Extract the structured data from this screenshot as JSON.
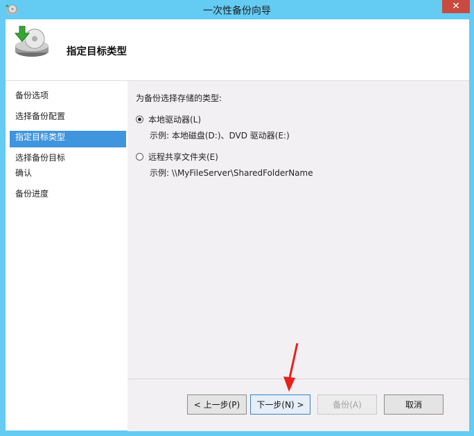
{
  "window": {
    "title": "一次性备份向导",
    "close_label": "✕"
  },
  "header": {
    "title": "指定目标类型"
  },
  "sidebar": {
    "items": [
      {
        "label": "备份选项"
      },
      {
        "label": "选择备份配置"
      },
      {
        "label": "指定目标类型"
      },
      {
        "label": "选择备份目标"
      },
      {
        "label": "确认"
      },
      {
        "label": "备份进度"
      }
    ]
  },
  "content": {
    "prompt": "为备份选择存储的类型:",
    "options": [
      {
        "label": "本地驱动器(L)",
        "example": "示例: 本地磁盘(D:)、DVD 驱动器(E:)",
        "selected": true
      },
      {
        "label": "远程共享文件夹(E)",
        "example": "示例: \\\\MyFileServer\\SharedFolderName",
        "selected": false
      }
    ]
  },
  "footer": {
    "prev_label": "< 上一步(P)",
    "next_label": "下一步(N) >",
    "backup_label": "备份(A)",
    "cancel_label": "取消"
  },
  "colors": {
    "accent": "#3f95de",
    "annotation_arrow": "#e8201c"
  }
}
